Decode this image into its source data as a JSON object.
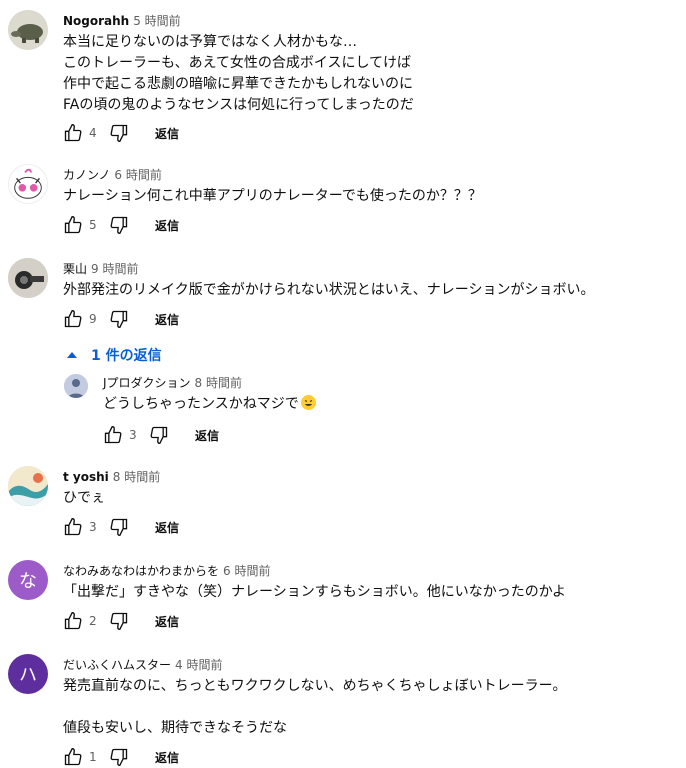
{
  "comments": [
    {
      "author": "Nogorahh",
      "time": "5 時間前",
      "text": "本当に足りないのは予算ではなく人材かもな…\nこのトレーラーも、あえて女性の合成ボイスにしてけば\n作中で起こる悲劇の暗喩に昇華できたかもしれないのに\nFAの頃の鬼のようなセンスは何処に行ってしまったのだ",
      "likes": "4",
      "reply_label": "返信"
    },
    {
      "author": "カノンノ",
      "time": "6 時間前",
      "text": "ナレーション何これ中華アプリのナレーターでも使ったのか？？？",
      "likes": "5",
      "reply_label": "返信"
    },
    {
      "author": "栗山",
      "time": "9 時間前",
      "text": "外部発注のリメイク版で金がかけられない状況とはいえ、ナレーションがショボい。",
      "likes": "9",
      "reply_label": "返信",
      "replies_toggle": "1 件の返信",
      "reply": {
        "author": "Jプロダクション",
        "time": "8 時間前",
        "text": "どうしちゃったンスかねマジで",
        "likes": "3",
        "reply_label": "返信"
      }
    },
    {
      "author": "t yoshi",
      "time": "8 時間前",
      "text": "ひでぇ",
      "likes": "3",
      "reply_label": "返信"
    },
    {
      "author": "なわみあなわはかわまからを",
      "time": "6 時間前",
      "avatar_letter": "な",
      "avatar_color": "#9c5bc8",
      "text": "「出撃だ」すきやな（笑）ナレーションすらもショボい。他にいなかったのかよ",
      "likes": "2",
      "reply_label": "返信"
    },
    {
      "author": "だいふくハムスター",
      "time": "4 時間前",
      "avatar_letter": "ハ",
      "avatar_color": "#5e2d9e",
      "text": "発売直前なのに、ちっともワクワクしない、めちゃくちゃしょぼいトレーラー。\n\n値段も安いし、期待できなそうだな",
      "likes": "1",
      "reply_label": "返信"
    }
  ]
}
